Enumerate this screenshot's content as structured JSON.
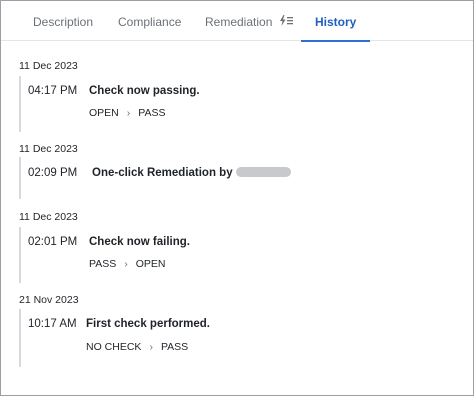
{
  "tabs": [
    {
      "label": "Description"
    },
    {
      "label": "Compliance"
    },
    {
      "label": "Remediation"
    },
    {
      "label": "History"
    }
  ],
  "active_tab": "History",
  "colors": {
    "accent": "#2f6fd0",
    "timeline_line": "#d6d9dd",
    "redacted": "#c7c9cc"
  },
  "history": [
    {
      "date": "11 Dec 2023",
      "time": "04:17 PM",
      "message": "Check now passing.",
      "from": "OPEN",
      "to": "PASS"
    },
    {
      "date": "11 Dec 2023",
      "time": "02:09 PM",
      "message": "One-click Remediation by"
    },
    {
      "date": "11 Dec 2023",
      "time": "02:01 PM",
      "message": "Check now failing.",
      "from": "PASS",
      "to": "OPEN"
    },
    {
      "date": "21 Nov 2023",
      "time": "10:17 AM",
      "message": "First check performed.",
      "from": "NO CHECK",
      "to": "PASS"
    }
  ],
  "icons": {
    "remediation": "lightning-list-icon",
    "transition": "chevron-right-icon"
  }
}
